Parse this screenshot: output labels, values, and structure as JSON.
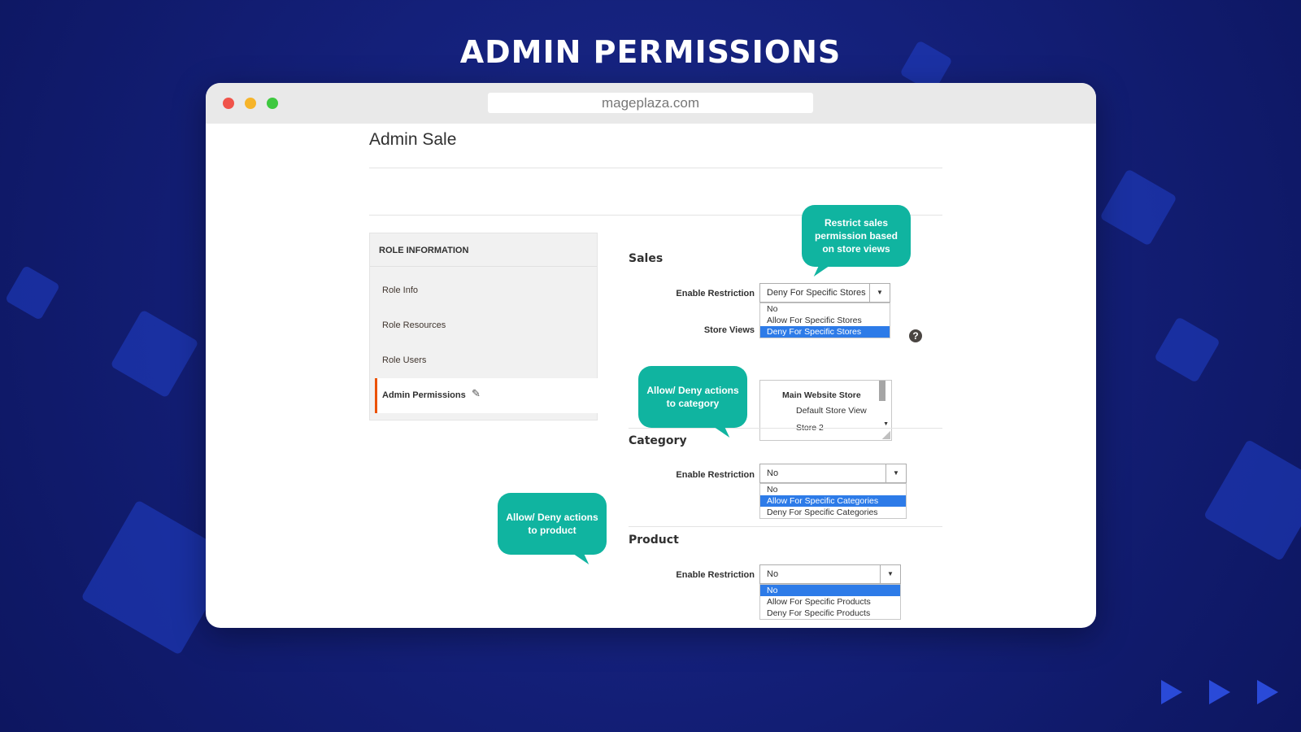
{
  "headline": "ADMIN PERMISSIONS",
  "browser": {
    "url": "mageplaza.com"
  },
  "page": {
    "title": "Admin Sale"
  },
  "sidenav": {
    "heading": "ROLE INFORMATION",
    "items": [
      {
        "label": "Role Info"
      },
      {
        "label": "Role Resources"
      },
      {
        "label": "Role Users"
      }
    ],
    "active": "Admin Permissions"
  },
  "sales": {
    "title": "Sales",
    "restriction_label": "Enable Restriction",
    "restriction_value": "Deny For Specific Stores",
    "restriction_options": [
      "No",
      "Allow For Specific Stores",
      "Deny For Specific Stores"
    ],
    "selected_option": "Deny For Specific Stores",
    "store_views_label": "Store Views",
    "store_group": "Main Website Store",
    "store_items": [
      "Default Store View",
      "Store 2"
    ]
  },
  "category": {
    "title": "Category",
    "restriction_label": "Enable Restriction",
    "restriction_value": "No",
    "restriction_options": [
      "No",
      "Allow For Specific Categories",
      "Deny For Specific Categories"
    ],
    "selected_option": "Allow For Specific Categories"
  },
  "product": {
    "title": "Product",
    "restriction_label": "Enable Restriction",
    "restriction_value": "No",
    "restriction_options": [
      "No",
      "Allow For Specific Products",
      "Deny For Specific Products"
    ],
    "selected_option": "No"
  },
  "callouts": {
    "sales": "Restrict sales permission based on store views",
    "category": "Allow/ Deny actions to category",
    "product": "Allow/ Deny actions to product"
  },
  "colors": {
    "accent_teal": "#10b4a0",
    "selection_blue": "#2d7be8",
    "active_border": "#eb5202"
  }
}
